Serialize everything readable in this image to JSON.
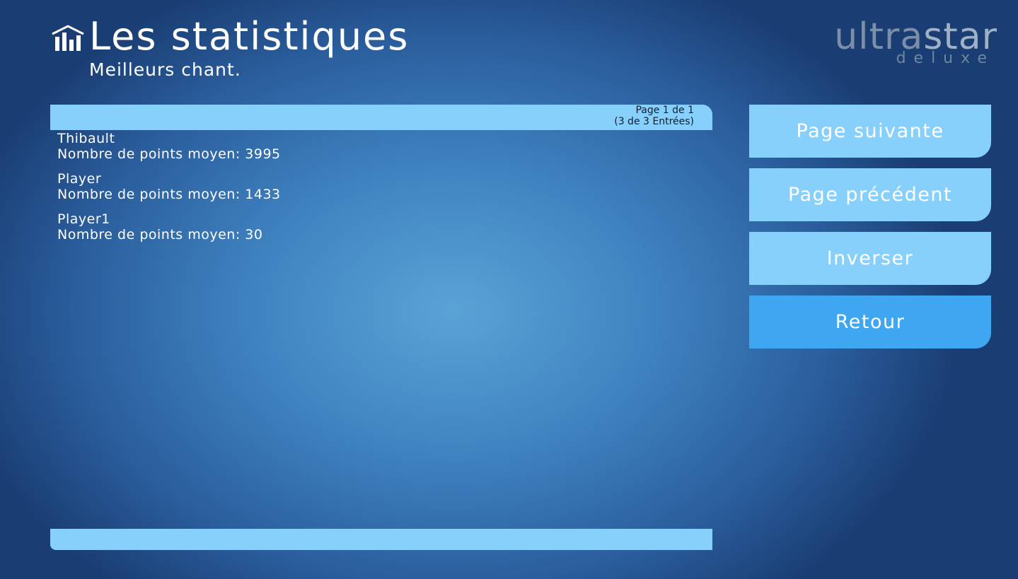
{
  "header": {
    "title": "Les statistiques",
    "subtitle": "Meilleurs chant.",
    "icon": "stats-bars-icon"
  },
  "logo": {
    "ultra": "ultra",
    "star": "star",
    "sub": "deluxe"
  },
  "panel": {
    "page_info_line1": "Page 1 de 1",
    "page_info_line2": "(3 de 3 Entrées)",
    "entries": [
      {
        "name": "Thibault",
        "score_line": "Nombre de points moyen: 3995"
      },
      {
        "name": "Player",
        "score_line": "Nombre de points moyen: 1433"
      },
      {
        "name": "Player1",
        "score_line": "Nombre de points moyen: 30"
      }
    ]
  },
  "buttons": {
    "next": "Page suivante",
    "prev": "Page précédent",
    "invert": "Inverser",
    "back": "Retour"
  },
  "colors": {
    "panel_bar": "#87d0fb",
    "button": "#87d0fb",
    "button_active": "#3fa6f2"
  }
}
